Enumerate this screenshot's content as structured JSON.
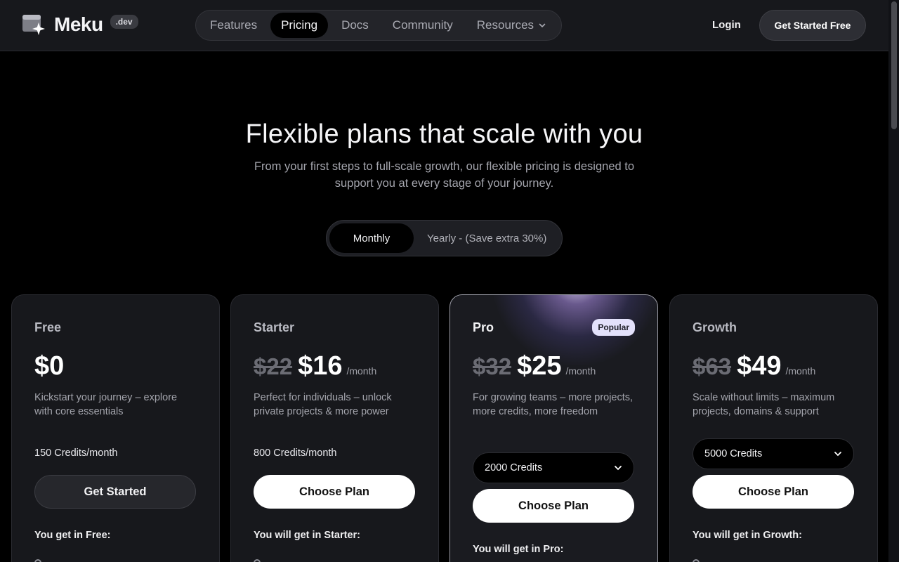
{
  "brand": {
    "name": "Meku",
    "badge": ".dev"
  },
  "nav": {
    "items": [
      {
        "label": "Features"
      },
      {
        "label": "Pricing"
      },
      {
        "label": "Docs"
      },
      {
        "label": "Community"
      },
      {
        "label": "Resources"
      }
    ],
    "active": "Pricing"
  },
  "header": {
    "login": "Login",
    "cta": "Get Started Free"
  },
  "hero": {
    "title": "Flexible plans that scale with you",
    "subtitle": "From your first steps to full-scale growth, our flexible pricing is designed to support you at every stage of your journey."
  },
  "billing": {
    "monthly": "Monthly",
    "yearly": "Yearly  - (Save extra 30%)",
    "selected": "Monthly"
  },
  "plans": [
    {
      "name": "Free",
      "price": "$0",
      "description": "Kickstart your journey – explore with core essentials",
      "credits": "150 Credits/month",
      "button": "Get Started",
      "includes": "You get in Free:"
    },
    {
      "name": "Starter",
      "old_price": "$22",
      "price": "$16",
      "period": "/month",
      "description": "Perfect for individuals – unlock private projects & more power",
      "credits": "800 Credits/month",
      "button": "Choose Plan",
      "includes": "You will get in Starter:"
    },
    {
      "name": "Pro",
      "badge": "Popular",
      "old_price": "$32",
      "price": "$25",
      "period": "/month",
      "description": "For growing teams – more projects, more credits, more freedom",
      "credits_select": "2000 Credits",
      "button": "Choose Plan",
      "includes": "You will get in Pro:"
    },
    {
      "name": "Growth",
      "old_price": "$63",
      "price": "$49",
      "period": "/month",
      "description": "Scale without limits – maximum projects, domains & support",
      "credits_select": "5000 Credits",
      "button": "Choose Plan",
      "includes": "You will get in Growth:"
    }
  ],
  "colors": {
    "background": "#000000",
    "card": "#17181c",
    "accent_badge": "#e3e1fb"
  },
  "icons": {
    "logo": "sparkle-window-icon",
    "dropdown": "chevron-down-icon"
  }
}
